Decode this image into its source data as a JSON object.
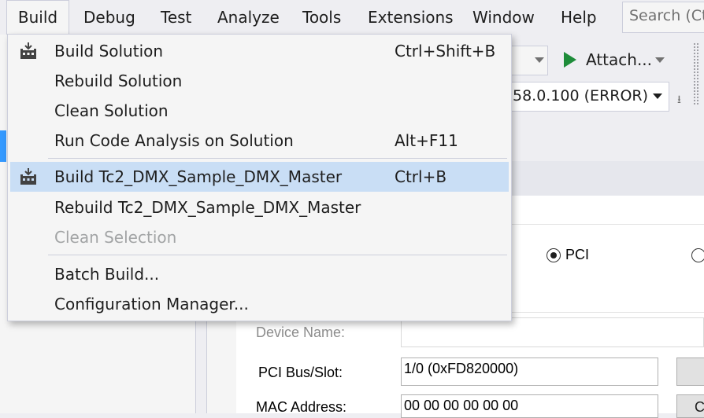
{
  "menubar": {
    "items": [
      "Build",
      "Debug",
      "Test",
      "Analyze",
      "Tools",
      "Extensions",
      "Window",
      "Help"
    ],
    "search_placeholder": "Search (Ct"
  },
  "toolbar": {
    "attach_label": "Attach...",
    "sdk_combo_value": "58.0.100 (ERROR)"
  },
  "build_menu": {
    "items": [
      {
        "label": "Build Solution",
        "shortcut": "Ctrl+Shift+B",
        "icon": "build-icon"
      },
      {
        "label": "Rebuild Solution",
        "shortcut": ""
      },
      {
        "label": "Clean Solution",
        "shortcut": ""
      },
      {
        "label": "Run Code Analysis on Solution",
        "shortcut": "Alt+F11"
      },
      {
        "label": "Build Tc2_DMX_Sample_DMX_Master",
        "shortcut": "Ctrl+B",
        "icon": "build-icon",
        "highlighted": true
      },
      {
        "label": "Rebuild Tc2_DMX_Sample_DMX_Master",
        "shortcut": ""
      },
      {
        "label": "Clean Selection",
        "shortcut": "",
        "disabled": true
      },
      {
        "label": "Batch Build...",
        "shortcut": ""
      },
      {
        "label": "Configuration Manager...",
        "shortcut": ""
      }
    ]
  },
  "device_panel": {
    "radio_pci_label": "PCI",
    "device_name_label": "Device Name:",
    "pci_bus_label": "PCI Bus/Slot:",
    "pci_bus_value": "1/0 (0xFD820000)",
    "mac_label": "MAC Address:",
    "mac_value": "00 00 00 00 00 00",
    "side_button_label": "C"
  },
  "colors": {
    "menu_highlight": "#c9def5",
    "accent": "#3399ff",
    "play_green": "#1e8c3a"
  }
}
